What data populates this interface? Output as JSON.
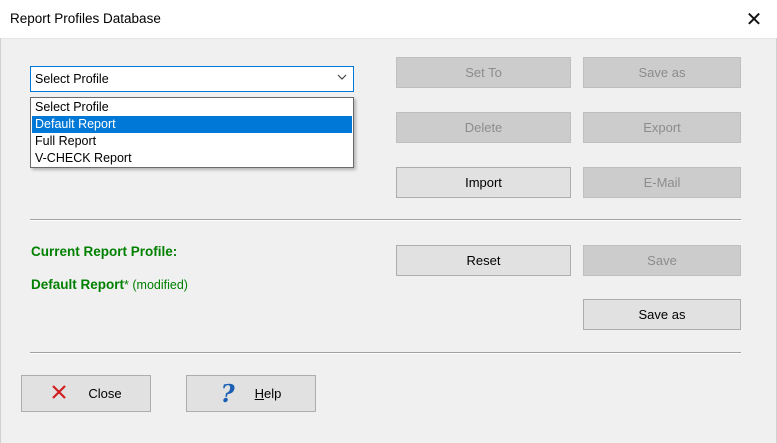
{
  "window": {
    "title": "Report Profiles Database",
    "close_glyph": "✕"
  },
  "profile_select": {
    "value": "Select Profile",
    "options": [
      "Select Profile",
      "Default Report",
      "Full Report",
      "V-CHECK Report"
    ],
    "highlighted_index": 1
  },
  "buttons": {
    "set_to": "Set To",
    "save_as_top": "Save as",
    "delete": "Delete",
    "export": "Export",
    "import": "Import",
    "email": "E-Mail",
    "reset": "Reset",
    "save": "Save",
    "save_as": "Save as",
    "close": "Close",
    "help_first": "H",
    "help_rest": "elp"
  },
  "current_profile": {
    "heading": "Current Report Profile:",
    "name": "Default Report",
    "asterisk": "*",
    "modified_note": " (modified)"
  },
  "colors": {
    "accent": "#0078d7",
    "profile_text": "#008000",
    "close_icon": "#d11f1f",
    "help_icon": "#1a5fb4"
  }
}
